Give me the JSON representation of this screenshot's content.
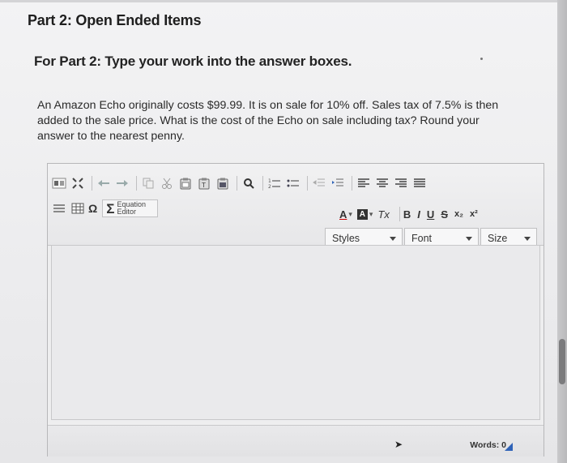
{
  "header": {
    "title": "Part 2: Open Ended Items"
  },
  "instructions": {
    "text": "For Part 2: Type your work into the answer boxes."
  },
  "question": {
    "text": "An Amazon Echo originally costs $99.99. It is on sale for 10% off. Sales tax of 7.5% is then added to the sale price. What is the cost of the Echo on sale including tax? Round your answer to the nearest penny."
  },
  "editor": {
    "toolbar_row1_icons": [
      "source-icon",
      "maximize-icon",
      "undo-icon",
      "redo-icon",
      "copy-icon",
      "cut-icon",
      "paste-icon",
      "paste-text-icon",
      "paste-word-icon",
      "find-icon",
      "numbered-list-icon",
      "bulleted-list-icon",
      "outdent-icon",
      "indent-icon",
      "align-left-icon",
      "align-center-icon",
      "align-right-icon",
      "justify-icon"
    ],
    "toolbar_row2_icons": [
      "horizontal-line-icon",
      "table-icon",
      "special-char-icon"
    ],
    "equation_editor_label": "Equation Editor",
    "sigma_symbol": "Σ",
    "omega_symbol": "Ω",
    "text_color_label": "A",
    "bg_color_label": "A",
    "remove_format_label": "Tx",
    "bold_label": "B",
    "italic_label": "I",
    "underline_label": "U",
    "strike_label": "S",
    "subscript_label": "x₂",
    "superscript_label": "x²",
    "styles_label": "Styles",
    "font_label": "Font",
    "size_label": "Size",
    "content": "",
    "words_label": "Words: 0"
  },
  "colors": {
    "accent": "#2f63b8",
    "background": "#ececee"
  }
}
